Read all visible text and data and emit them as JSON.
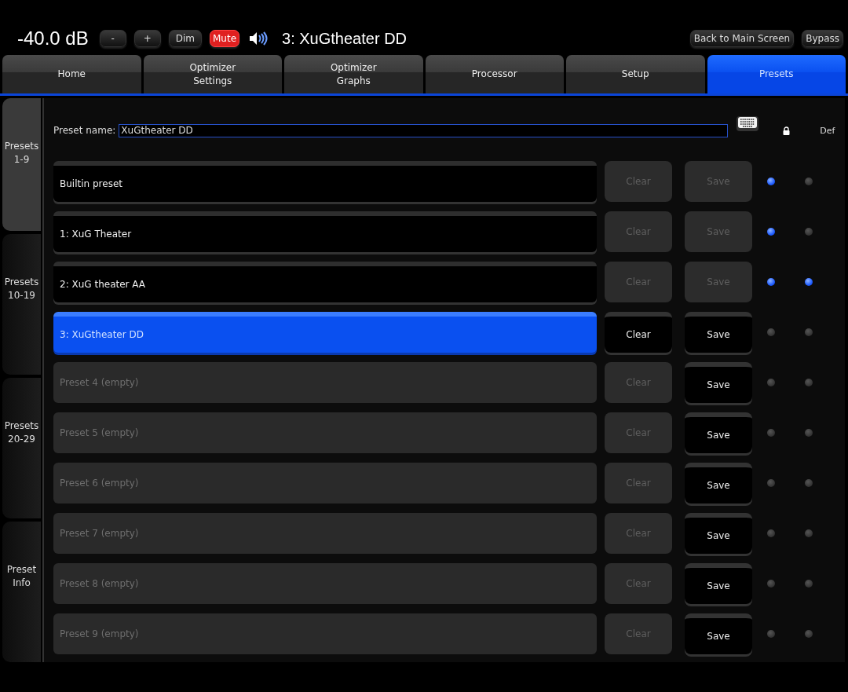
{
  "top_bar": {
    "volume": "-40.0 dB",
    "buttons": [
      {
        "label": "-",
        "kind": "plain"
      },
      {
        "label": "+",
        "kind": "plain"
      },
      {
        "label": "Dim",
        "kind": "plain"
      },
      {
        "label": "Mute",
        "kind": "mute",
        "on": true
      }
    ],
    "current_preset": "3: XuGtheater DD",
    "right_buttons": [
      "Back to Main Screen",
      "Bypass"
    ]
  },
  "tabs": [
    {
      "label": "Home",
      "selected": false
    },
    {
      "label": "Optimizer\nSettings",
      "selected": false
    },
    {
      "label": "Optimizer\nGraphs",
      "selected": false
    },
    {
      "label": "Processor",
      "selected": false
    },
    {
      "label": "Setup",
      "selected": false
    },
    {
      "label": "Presets",
      "selected": true
    }
  ],
  "side_tabs": [
    {
      "label": "Presets\n1-9",
      "selected": true
    },
    {
      "label": "Presets\n10-19",
      "selected": false
    },
    {
      "label": "Presets\n20-29",
      "selected": false
    },
    {
      "label": "Preset\nInfo",
      "selected": false
    }
  ],
  "preset_name": {
    "label": "Preset name:",
    "value": "XuGtheater DD"
  },
  "columns": {
    "default": "Def"
  },
  "presets": [
    {
      "name": "Builtin preset",
      "empty": false,
      "selected": false,
      "clear": "Clear",
      "clear_disabled": true,
      "save": "Save",
      "save_disabled": true,
      "locked": true,
      "default": false
    },
    {
      "name": "1: XuG Theater",
      "empty": false,
      "selected": false,
      "clear": "Clear",
      "clear_disabled": true,
      "save": "Save",
      "save_disabled": true,
      "locked": true,
      "default": false
    },
    {
      "name": "2: XuG theater AA",
      "empty": false,
      "selected": false,
      "clear": "Clear",
      "clear_disabled": true,
      "save": "Save",
      "save_disabled": true,
      "locked": true,
      "default": true
    },
    {
      "name": "3: XuGtheater DD",
      "empty": false,
      "selected": true,
      "clear": "Clear",
      "clear_disabled": false,
      "save": "Save",
      "save_disabled": false,
      "locked": false,
      "default": false
    },
    {
      "name": "Preset 4 (empty)",
      "empty": true,
      "selected": false,
      "clear": "Clear",
      "clear_disabled": true,
      "save": "Save",
      "save_disabled": false,
      "locked": false,
      "default": false
    },
    {
      "name": "Preset 5 (empty)",
      "empty": true,
      "selected": false,
      "clear": "Clear",
      "clear_disabled": true,
      "save": "Save",
      "save_disabled": false,
      "locked": false,
      "default": false
    },
    {
      "name": "Preset 6 (empty)",
      "empty": true,
      "selected": false,
      "clear": "Clear",
      "clear_disabled": true,
      "save": "Save",
      "save_disabled": false,
      "locked": false,
      "default": false
    },
    {
      "name": "Preset 7 (empty)",
      "empty": true,
      "selected": false,
      "clear": "Clear",
      "clear_disabled": true,
      "save": "Save",
      "save_disabled": false,
      "locked": false,
      "default": false
    },
    {
      "name": "Preset 8 (empty)",
      "empty": true,
      "selected": false,
      "clear": "Clear",
      "clear_disabled": true,
      "save": "Save",
      "save_disabled": false,
      "locked": false,
      "default": false
    },
    {
      "name": "Preset 9 (empty)",
      "empty": true,
      "selected": false,
      "clear": "Clear",
      "clear_disabled": true,
      "save": "Save",
      "save_disabled": false,
      "locked": false,
      "default": false
    }
  ]
}
